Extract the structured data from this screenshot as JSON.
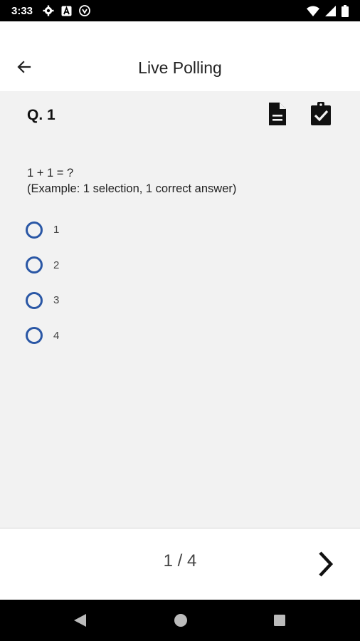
{
  "status_bar": {
    "time": "3:33",
    "left_icons": [
      "gear-icon",
      "a-box-icon",
      "shield-icon"
    ],
    "right_icons": [
      "wifi-icon",
      "signal-icon",
      "battery-icon"
    ]
  },
  "app_bar": {
    "title": "Live Polling",
    "back_icon": "arrow-left-icon"
  },
  "question": {
    "number_label": "Q. 1",
    "doc_icon": "document-icon",
    "check_icon": "clipboard-check-icon",
    "text_line1": "1 + 1 = ?",
    "text_line2": "(Example: 1 selection, 1 correct answer)",
    "options": [
      "1",
      "2",
      "3",
      "4"
    ],
    "accent_color": "#2a57a5"
  },
  "footer": {
    "page_indicator": "1 / 4",
    "next_icon": "chevron-right-icon"
  },
  "nav_bar": {
    "icons": [
      "nav-back-icon",
      "nav-home-icon",
      "nav-recent-icon"
    ]
  }
}
